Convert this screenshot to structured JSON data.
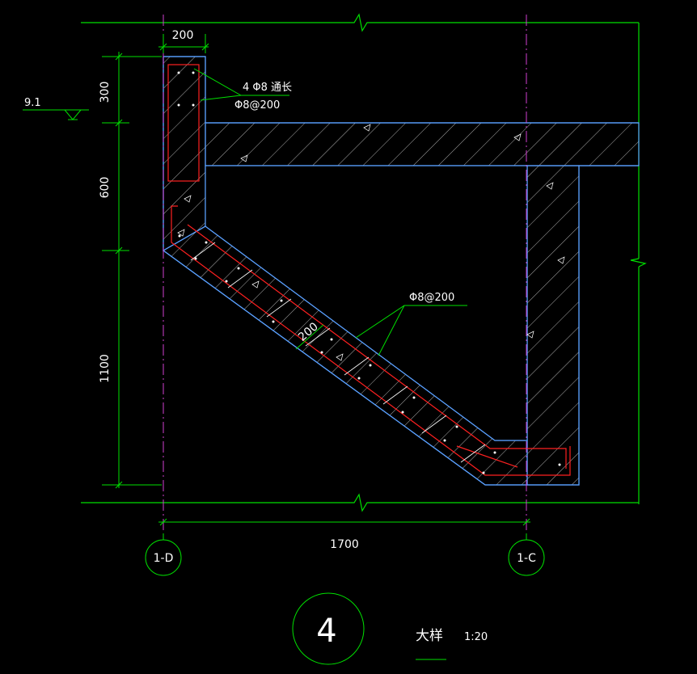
{
  "drawing": {
    "elevation_label": "9.1",
    "dims": {
      "top_width": "200",
      "left_300": "300",
      "left_600": "600",
      "left_1100": "1100",
      "bottom_1700": "1700",
      "slab_thickness": "200"
    },
    "rebar_notes": {
      "longitudinal": "4 Φ8 通长",
      "stirrup_top": "Φ8@200",
      "stirrup_slope": "Φ8@200"
    },
    "axes": {
      "left": "1-D",
      "right": "1-C"
    },
    "detail": {
      "number": "4",
      "title": "大样",
      "scale": "1:20"
    }
  },
  "colors": {
    "background": "#000000",
    "dimension_line": "#00e000",
    "concrete_outline": "#5aa0ff",
    "rebar": "#ff2020",
    "axis_line": "#d040d0",
    "text": "#ffffff"
  }
}
